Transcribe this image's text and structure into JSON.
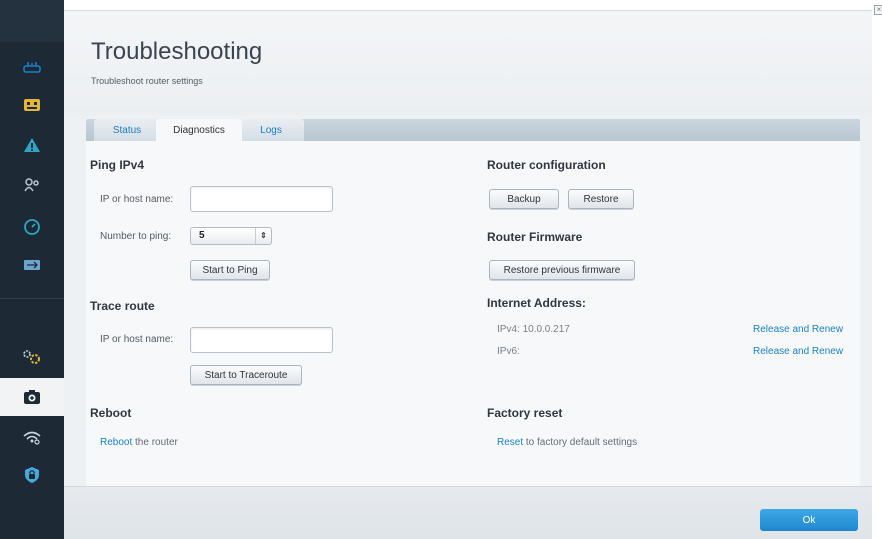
{
  "sidebar": {
    "items": [
      {
        "icon": "router-icon"
      },
      {
        "icon": "devices-icon"
      },
      {
        "icon": "alert-icon"
      },
      {
        "icon": "parental-icon"
      },
      {
        "icon": "speed-icon"
      },
      {
        "icon": "usb-icon"
      },
      {
        "icon": "settings-icon"
      },
      {
        "icon": "troubleshooting-icon"
      },
      {
        "icon": "wifi-icon"
      },
      {
        "icon": "security-icon"
      }
    ]
  },
  "header": {
    "title": "Troubleshooting",
    "subtitle": "Troubleshoot router settings"
  },
  "tabs": [
    {
      "label": "Status"
    },
    {
      "label": "Diagnostics"
    },
    {
      "label": "Logs"
    }
  ],
  "ping": {
    "heading": "Ping IPv4",
    "host_label": "IP or host name:",
    "host_value": "",
    "count_label": "Number to ping:",
    "count_value": "5",
    "start_label": "Start to Ping"
  },
  "trace": {
    "heading": "Trace route",
    "host_label": "IP or host name:",
    "host_value": "",
    "start_label": "Start to Traceroute"
  },
  "reboot": {
    "heading": "Reboot",
    "link": "Reboot",
    "rest": " the router"
  },
  "router_config": {
    "heading": "Router configuration",
    "backup_label": "Backup",
    "restore_label": "Restore"
  },
  "firmware": {
    "heading": "Router Firmware",
    "restore_label": "Restore previous firmware"
  },
  "internet": {
    "heading": "Internet Address:",
    "ipv4_label": "IPv4: 10.0.0.217",
    "ipv4_action": "Release and Renew",
    "ipv6_label": "IPv6:",
    "ipv6_action": "Release and Renew"
  },
  "factory": {
    "heading": "Factory reset",
    "link": "Reset",
    "rest": " to factory default settings"
  },
  "footer": {
    "ok_label": "Ok"
  },
  "colors": {
    "accent": "#1e86cf",
    "link": "#1a82c7",
    "sidebar": "#1d2a36"
  }
}
